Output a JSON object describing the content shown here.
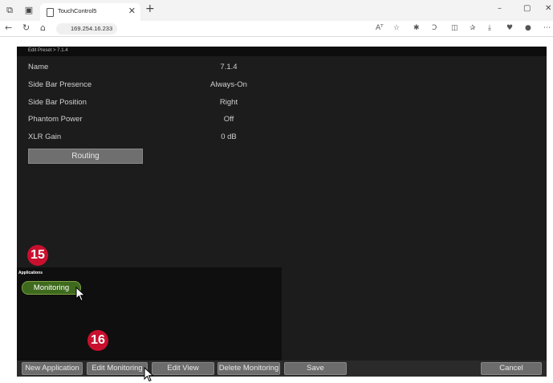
{
  "browser": {
    "tab_title": "TouchControl5",
    "url": "169.254.16.233",
    "icons": {
      "workspaces": "⧉",
      "tab_actions": "▣",
      "close_tab": "✕",
      "new_tab": "+",
      "minimize": "–",
      "restore": "▢",
      "close_window": "✕",
      "back": "←",
      "refresh": "↻",
      "home": "⌂",
      "read_aloud": "Aᵀ",
      "favorite": "☆",
      "extension": "✱",
      "copilot": "Ↄ",
      "split": "◫",
      "favorites": "✰",
      "downloads": "⤓",
      "browser_essentials": "♥",
      "profile": "●",
      "more": "⋯"
    }
  },
  "app": {
    "breadcrumb": "Edit Preset > 7.1.4",
    "properties": [
      {
        "label": "Name",
        "value": "7.1.4"
      },
      {
        "label": "Side Bar Presence",
        "value": "Always-On"
      },
      {
        "label": "Side Bar Position",
        "value": "Right"
      },
      {
        "label": "Phantom Power",
        "value": "Off"
      },
      {
        "label": "XLR Gain",
        "value": "0 dB"
      }
    ],
    "routing_label": "Routing",
    "applications_label": "Applications",
    "monitoring_label": "Monitoring",
    "bottom_buttons": {
      "new_application": "New Application",
      "edit_monitoring": "Edit Monitoring",
      "edit_view": "Edit View",
      "delete_monitoring": "Delete Monitoring",
      "save": "Save",
      "cancel": "Cancel"
    },
    "callouts": {
      "a": "15",
      "b": "16"
    },
    "colors": {
      "badge": "#c8102e",
      "monitoring": "#3e6a1e",
      "panel": "#1c1c1c"
    }
  }
}
